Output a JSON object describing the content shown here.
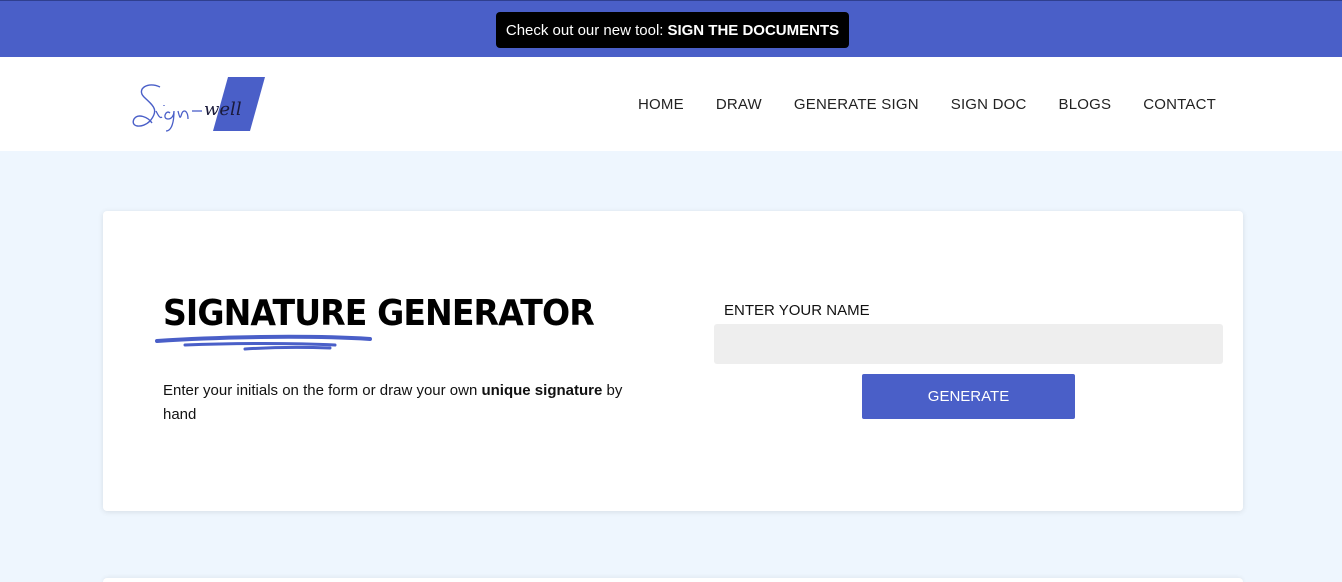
{
  "promo": {
    "prefix": "Check out our new tool:",
    "highlight": "SIGN THE DOCUMENTS"
  },
  "header": {
    "logo_text": "Sign-well",
    "nav": [
      "HOME",
      "DRAW",
      "GENERATE SIGN",
      "SIGN DOC",
      "BLOGS",
      "CONTACT"
    ]
  },
  "hero": {
    "title": "SIGNATURE GENERATOR",
    "description_prefix": "Enter your initials on the form or draw your own ",
    "description_bold": "unique signature",
    "description_suffix": " by hand"
  },
  "form": {
    "label": "ENTER YOUR NAME",
    "value": "",
    "placeholder": "",
    "button_label": "GENERATE"
  },
  "colors": {
    "brand": "#4a5fc8",
    "page_bg": "#eef6fe",
    "input_bg": "#eeeeee"
  }
}
